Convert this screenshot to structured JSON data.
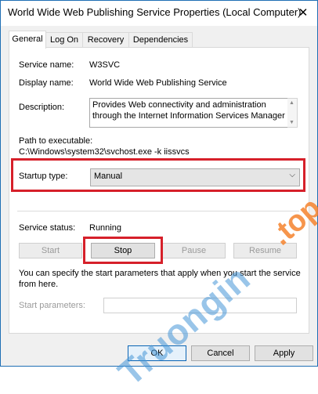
{
  "window": {
    "title": "World Wide Web Publishing Service Properties (Local Computer)",
    "close_glyph": "✕"
  },
  "tabs": [
    {
      "label": "General",
      "active": true
    },
    {
      "label": "Log On",
      "active": false
    },
    {
      "label": "Recovery",
      "active": false
    },
    {
      "label": "Dependencies",
      "active": false
    }
  ],
  "general": {
    "service_name_label": "Service name:",
    "service_name_value": "W3SVC",
    "display_name_label": "Display name:",
    "display_name_value": "World Wide Web Publishing Service",
    "description_label": "Description:",
    "description_value": "Provides Web connectivity and administration through the Internet Information Services Manager",
    "path_label": "Path to executable:",
    "path_value": "C:\\Windows\\system32\\svchost.exe -k iissvcs",
    "startup_type_label": "Startup type:",
    "startup_type_value": "Manual",
    "service_status_label": "Service status:",
    "service_status_value": "Running",
    "start_label": "Start",
    "stop_label": "Stop",
    "pause_label": "Pause",
    "resume_label": "Resume",
    "help_text": "You can specify the start parameters that apply when you start the service from here.",
    "start_params_label": "Start parameters:",
    "start_params_value": ""
  },
  "footer": {
    "ok_label": "OK",
    "cancel_label": "Cancel",
    "apply_label": "Apply"
  },
  "watermark": {
    "text": "Truongin",
    "tld": ".top"
  },
  "colors": {
    "highlight_box": "#d6202a",
    "window_border": "#1f6fb5"
  },
  "icons": {
    "dropdown": "chevron-down-icon",
    "scroll_up": "triangle-up-icon",
    "scroll_down": "triangle-down-icon"
  }
}
